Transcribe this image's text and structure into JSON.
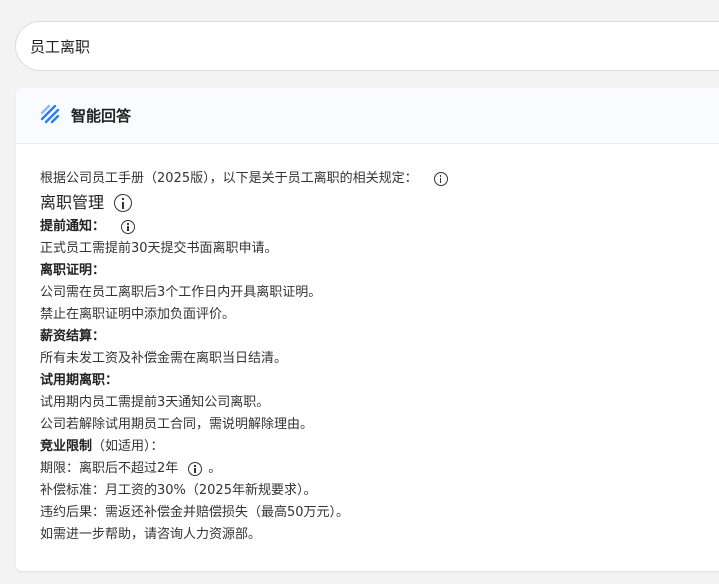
{
  "search": {
    "value": "员工离职"
  },
  "card": {
    "title": "智能回答",
    "intro": "根据公司员工手册（2025版），以下是关于员工离职的相关规定：",
    "heading": "离职管理",
    "sections": [
      {
        "title": "提前通知：",
        "lines": [
          "正式员工需提前30天提交书面离职申请。"
        ]
      },
      {
        "title": "离职证明：",
        "lines": [
          "公司需在员工离职后3个工作日内开具离职证明。",
          "禁止在离职证明中添加负面评价。"
        ]
      },
      {
        "title": "薪资结算：",
        "lines": [
          "所有未发工资及补偿金需在离职当日结清。"
        ]
      },
      {
        "title": "试用期离职：",
        "lines": [
          "试用期内员工需提前3天通知公司离职。",
          "公司若解除试用期员工合同，需说明解除理由。"
        ]
      },
      {
        "title": "竞业限制",
        "title_suffix": "（如适用）：",
        "lines": [
          "期限：离职后不超过2年",
          "补偿标准：月工资的30%（2025年新规要求）。",
          "违约后果：需返还补偿金并赔偿损失（最高50万元）。"
        ],
        "line0_suffix": "。"
      }
    ],
    "footer": "如需进一步帮助，请咨询人力资源部。"
  },
  "colors": {
    "accent": "#2b7cf6"
  }
}
